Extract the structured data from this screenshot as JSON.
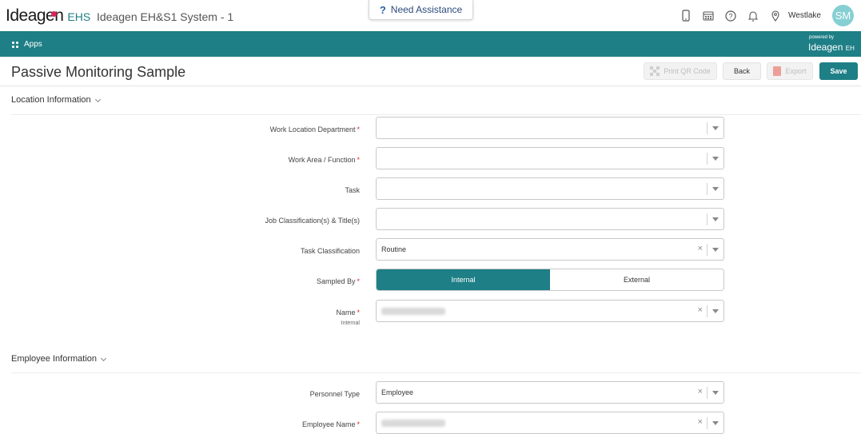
{
  "header": {
    "logo_text": "Ideagen",
    "logo_suffix": "EHS",
    "system_title": "Ideagen EH&S1 System - 1",
    "assist_label": "Need Assistance",
    "location": "Westlake",
    "avatar_initials": "SM",
    "icons": [
      "mobile-icon",
      "calendar-icon",
      "help-icon",
      "bell-icon",
      "location-pin-icon"
    ]
  },
  "navbar": {
    "apps_label": "Apps",
    "powered_by": "powered by",
    "powered_logo": "Ideagen",
    "powered_suffix": "EH"
  },
  "page": {
    "title": "Passive Monitoring Sample",
    "buttons": {
      "qr": "Print QR Code",
      "back": "Back",
      "export": "Export",
      "save": "Save"
    }
  },
  "location_section": {
    "title": "Location Information",
    "fields": {
      "work_location_department": {
        "label": "Work Location Department",
        "required": "*",
        "value": ""
      },
      "work_area": {
        "label": "Work Area / Function",
        "required": "*",
        "value": ""
      },
      "task": {
        "label": "Task",
        "value": ""
      },
      "job_classification": {
        "label": "Job Classification(s) & Title(s)",
        "value": ""
      },
      "task_classification": {
        "label": "Task Classification",
        "value": "Routine"
      },
      "sampled_by": {
        "label": "Sampled By",
        "required": "*",
        "options": [
          "Internal",
          "External"
        ],
        "selected": "Internal"
      },
      "name": {
        "label": "Name",
        "required": "*",
        "sublabel": "Internal"
      }
    }
  },
  "employee_section": {
    "title": "Employee Information",
    "fields": {
      "personnel_type": {
        "label": "Personnel Type",
        "value": "Employee"
      },
      "employee_name": {
        "label": "Employee Name",
        "required": "*"
      }
    }
  },
  "colors": {
    "accent": "#1e7f86",
    "required": "#d9262b",
    "brand_dot": "#d8265a",
    "avatar": "#86cfd3"
  }
}
